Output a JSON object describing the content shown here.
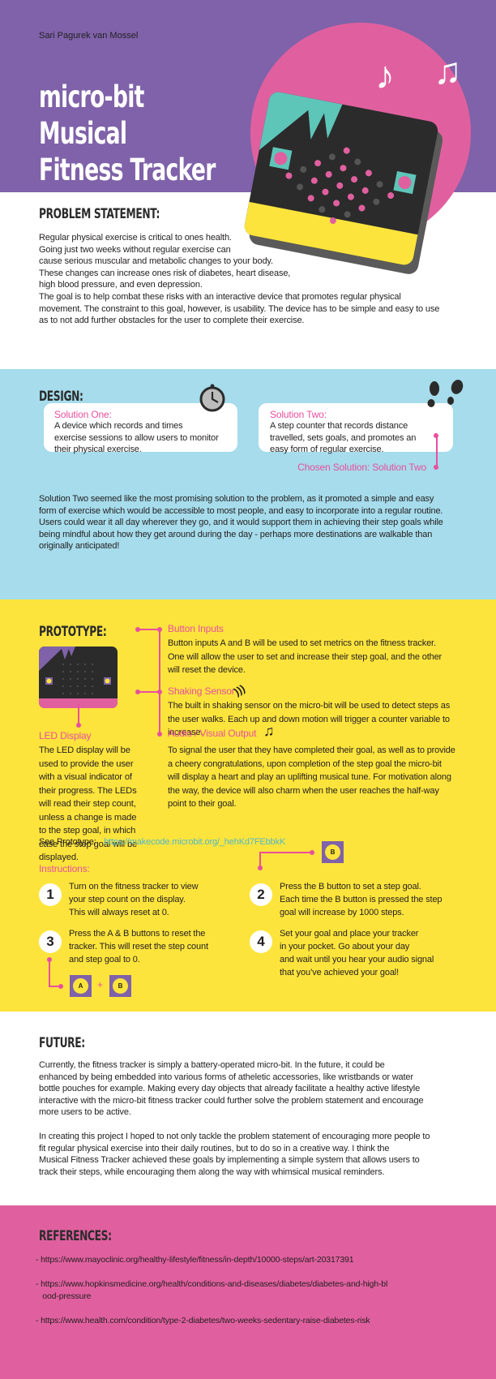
{
  "colors": {
    "purple": "#7f62a9",
    "pink": "#e0609f",
    "blue": "#a6dceb",
    "yellow": "#fde43c",
    "teal": "#5ec5b9",
    "dark": "#2b2b2b",
    "accent_text": "#e94f9e",
    "link": "#4fb8c8"
  },
  "header": {
    "author": "Sari Pagurek van Mossel",
    "title_lines": [
      "micro-bit",
      "Musical",
      "Fitness Tracker"
    ],
    "icons": [
      "music-note-icon",
      "beamed-music-notes-icon",
      "microbit-device-illustration"
    ]
  },
  "problem": {
    "heading": "PROBLEM STATEMENT:",
    "lines": [
      "Regular physical exercise is critical to ones health.",
      "Going just two weeks without regular exercise can",
      "cause serious muscular and metabolic changes to your body.",
      "These changes can increase ones risk of diabetes, heart disease,",
      "high blood pressure, and even depression.",
      "The goal is to help combat these risks with an interactive device that promotes regular physical",
      "movement. The constraint to this goal, however, is usability. The device has to be simple and easy to use",
      "as to not add further obstacles for the user to complete their exercise."
    ]
  },
  "design": {
    "heading": "DESIGN:",
    "solution_one": {
      "label": "Solution One:",
      "lines": [
        "A device which records and times",
        "exercise sessions to allow users to monitor",
        "their physical exercise."
      ],
      "icon": "stopwatch-icon"
    },
    "solution_two": {
      "label": "Solution Two:",
      "lines": [
        "A step counter that records distance",
        "travelled, sets goals, and promotes an",
        "easy form of regular exercise."
      ],
      "icon": "footprints-icon"
    },
    "chosen": "Chosen Solution: Solution Two",
    "lines": [
      "Solution Two seemed like the most promising solution to the problem, as it promoted a simple and easy",
      "form of exercise which would be accessible to most people, and easy to incorporate into a regular routine.",
      "Users could wear it all day wherever they go, and it would support them in achieving their step goals while",
      "being mindful about how they get around during the day - perhaps more destinations are walkable than",
      "originally anticipated!"
    ]
  },
  "prototype": {
    "heading": "PROTOTYPE:",
    "led": {
      "label": "LED Display",
      "lines": [
        "The LED display will be",
        "used to provide the user",
        "with a visual indicator of",
        "their progress. The LEDs",
        "will read their step count,",
        "unless a change is made",
        "to the step goal, in which",
        "case the step goal will be",
        "displayed."
      ]
    },
    "buttons": {
      "label": "Button Inputs",
      "lines": [
        "Button inputs A and B will be used to set metrics on the fitness tracker.",
        "One will allow the user to set and increase their step goal, and the other",
        "will reset the device."
      ]
    },
    "shake": {
      "label": "Shaking Sensor",
      "icon": "vibration-icon",
      "lines": [
        "The built in shaking sensor on the micro-bit will be used to detect steps as",
        "the user walks. Each up and down motion will trigger a counter variable to",
        "increase."
      ]
    },
    "audio": {
      "label": "Audio / Visual Output",
      "icon": "music-note-icon",
      "lines": [
        "To signal the user that they have completed their goal, as well as to provide",
        "a cheery congratulations, upon completion of the step goal the micro-bit",
        "will display a heart and play an uplifting musical tune. For motivation along",
        "the way, the device will also charm when the user reaches the half-way",
        "point to their goal."
      ]
    },
    "see_label": "See Prototype:",
    "link": "https://makecode.microbit.org/_hehKd7FEbbkK",
    "instructions_label": "Instructions:",
    "steps": [
      {
        "n": "1",
        "lines": [
          "Turn on the fitness tracker to view",
          "your step count on the display.",
          "This will always reset at 0."
        ]
      },
      {
        "n": "2",
        "lines": [
          "Press the B button to set a step goal.",
          "Each time the B button is pressed the step",
          "goal will increase by 1000 steps."
        ]
      },
      {
        "n": "3",
        "lines": [
          "Press the A & B buttons to reset the",
          "tracker. This will reset the step count",
          "and step goal to 0."
        ]
      },
      {
        "n": "4",
        "lines": [
          "Set your goal and place your tracker",
          "in your pocket. Go about your day",
          "and wait until you hear your audio signal",
          "that you’ve achieved your goal!"
        ]
      }
    ],
    "btn_a": "A",
    "btn_b": "B",
    "plus": "+"
  },
  "future": {
    "heading": "FUTURE:",
    "p1": [
      "Currently, the fitness tracker is simply a battery-operated micro-bit. In the future, it could be",
      "enhanced by being embedded into various forms of atheletic accessories, like wristbands or water",
      "bottle pouches for example. Making every day objects that already facilitate a healthy active lifestyle",
      "interactive with the micro-bit fitness tracker could further solve the problem statement and encourage",
      "more users to be active."
    ],
    "p2": [
      "In creating this project I hoped to not only tackle the problem statement of encouraging more people to",
      "fit regular physical exercise into their daily routines, but to do so in a creative way. I think the",
      "Musical Fitness Tracker achieved these goals by implementing a simple system that allows users to",
      "track their steps, while encouraging them along the way with whimsical musical reminders."
    ]
  },
  "references": {
    "heading": "REFERENCES:",
    "items": [
      [
        "- https://www.mayoclinic.org/healthy-lifestyle/fitness/in-depth/10000-steps/art-20317391"
      ],
      [
        "- https://www.hopkinsmedicine.org/health/conditions-and-diseases/diabetes/diabetes-and-high-bl",
        "   ood-pressure"
      ],
      [
        "- https://www.health.com/condition/type-2-diabetes/two-weeks-sedentary-raise-diabetes-risk"
      ]
    ]
  }
}
